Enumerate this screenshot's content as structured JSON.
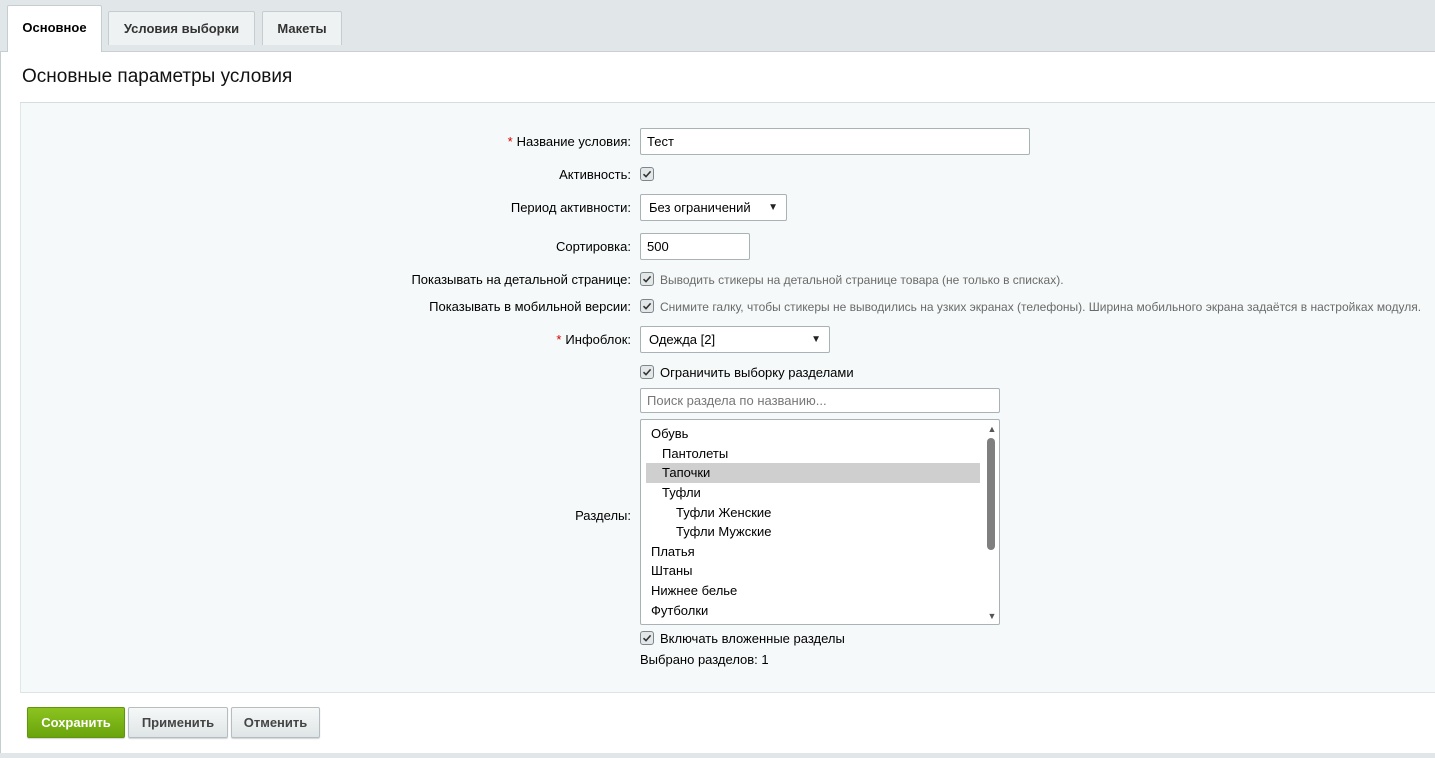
{
  "tabs": [
    {
      "label": "Основное",
      "active": true
    },
    {
      "label": "Условия выборки",
      "active": false
    },
    {
      "label": "Макеты",
      "active": false
    }
  ],
  "section_title": "Основные параметры условия",
  "form": {
    "name_label": "Название условия:",
    "name_value": "Тест",
    "active_label": "Активность:",
    "active_checked": true,
    "period_label": "Период активности:",
    "period_value": "Без ограничений",
    "sort_label": "Сортировка:",
    "sort_value": "500",
    "detail_label": "Показывать на детальной странице:",
    "detail_hint": "Выводить стикеры на детальной странице товара (не только в списках).",
    "mobile_label": "Показывать в мобильной версии:",
    "mobile_hint": "Снимите галку, чтобы стикеры не выводились на узких экранах (телефоны). Ширина мобильного экрана задаётся в настройках модуля.",
    "iblock_label": "Инфоблок:",
    "iblock_value": "Одежда [2]",
    "restrict_label": "Ограничить выборку разделами",
    "search_placeholder": "Поиск раздела по названию...",
    "sections_label": "Разделы:",
    "sections": [
      {
        "label": "Обувь",
        "level": 0,
        "selected": false
      },
      {
        "label": "Пантолеты",
        "level": 1,
        "selected": false
      },
      {
        "label": "Тапочки",
        "level": 1,
        "selected": true
      },
      {
        "label": "Туфли",
        "level": 1,
        "selected": false
      },
      {
        "label": "Туфли Женские",
        "level": 2,
        "selected": false
      },
      {
        "label": "Туфли Мужские",
        "level": 2,
        "selected": false
      },
      {
        "label": "Платья",
        "level": 0,
        "selected": false
      },
      {
        "label": "Штаны",
        "level": 0,
        "selected": false
      },
      {
        "label": "Нижнее белье",
        "level": 0,
        "selected": false
      },
      {
        "label": "Футболки",
        "level": 0,
        "selected": false
      }
    ],
    "include_nested_label": "Включать вложенные разделы",
    "selected_count_text": "Выбрано разделов: 1"
  },
  "buttons": {
    "save": "Сохранить",
    "apply": "Применить",
    "cancel": "Отменить"
  },
  "colors": {
    "required": "#d40000",
    "save_button": "#76b015",
    "selected_row": "#cfcfcf"
  }
}
